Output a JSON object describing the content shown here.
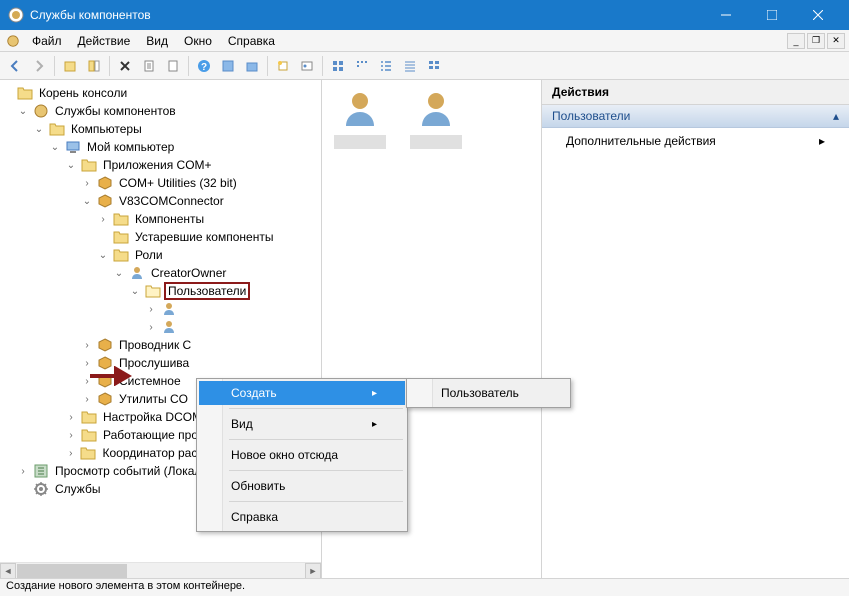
{
  "window": {
    "title": "Службы компонентов"
  },
  "menu": {
    "file": "Файл",
    "action": "Действие",
    "view": "Вид",
    "window": "Окно",
    "help": "Справка"
  },
  "tree": {
    "root": "Корень консоли",
    "comp_services": "Службы компонентов",
    "computers": "Компьютеры",
    "my_computer": "Мой компьютер",
    "com_apps": "Приложения COM+",
    "com_utilities": "COM+ Utilities (32 bit)",
    "v83connector": "V83COMConnector",
    "components": "Компоненты",
    "legacy_components": "Устаревшие компоненты",
    "roles": "Роли",
    "creator_owner": "CreatorOwner",
    "users": "Пользователи",
    "conductor": "Проводник C",
    "listener": "Прослушива",
    "system": "Системное",
    "utilities": "Утилиты CO",
    "dcom_config": "Настройка DCOM",
    "running_processes": "Работающие процессы",
    "dtc": "Координатор распределенных транзак",
    "event_viewer": "Просмотр событий (Локальный)",
    "services": "Службы"
  },
  "context": {
    "create": "Создать",
    "view": "Вид",
    "new_window": "Новое окно отсюда",
    "refresh": "Обновить",
    "help": "Справка",
    "user": "Пользователь"
  },
  "actions": {
    "header": "Действия",
    "category": "Пользователи",
    "more": "Дополнительные действия"
  },
  "status": "Создание нового элемента в этом контейнере."
}
